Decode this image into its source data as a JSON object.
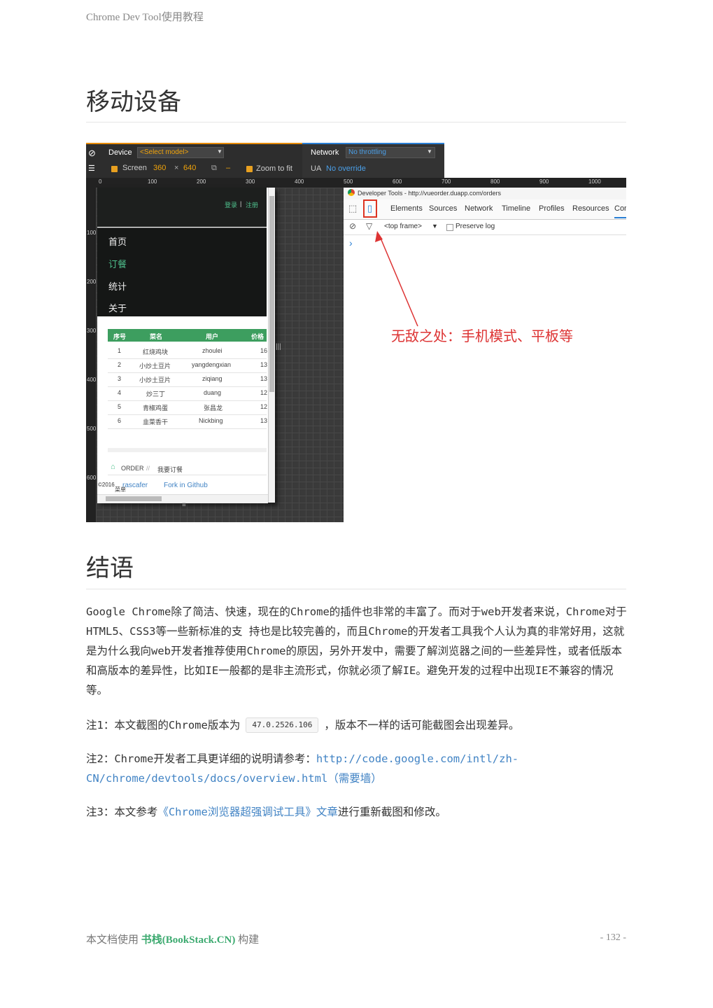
{
  "header": {
    "doc_title": "Chrome Dev Tool使用教程"
  },
  "section1": {
    "title": "移动设备"
  },
  "screenshot": {
    "toolbar": {
      "device_label": "Device",
      "device_select": "<Select model>",
      "screen_label": "Screen",
      "width": "360",
      "times": "×",
      "height": "640",
      "dash": "–",
      "zoom_label": "Zoom to fit",
      "network_label": "Network",
      "network_select": "No throttling",
      "ua_label": "UA",
      "ua_value": "No override"
    },
    "ruler_top": [
      "0",
      "100",
      "200",
      "300",
      "400",
      "500",
      "600",
      "700",
      "800",
      "900",
      "1000"
    ],
    "ruler_left": [
      "100",
      "200",
      "300",
      "400",
      "500",
      "600"
    ],
    "phone": {
      "login": "登录",
      "sep": "|",
      "register": "注册",
      "menu": [
        "首页",
        "订餐",
        "统计",
        "关于"
      ],
      "table_headers": [
        "序号",
        "菜名",
        "用户",
        "价格"
      ],
      "rows": [
        [
          "1",
          "红烧鸡块",
          "zhoulei",
          "16"
        ],
        [
          "2",
          "小炒土豆片",
          "yangdengxian",
          "13"
        ],
        [
          "3",
          "小炒土豆片",
          "ziqiang",
          "13"
        ],
        [
          "4",
          "炒三丁",
          "duang",
          "12"
        ],
        [
          "5",
          "青椒鸡蛋",
          "张昌龙",
          "12"
        ],
        [
          "6",
          "韭菜香干",
          "Nickbing",
          "13"
        ]
      ],
      "breadcrumb_order": "ORDER",
      "breadcrumb_sep": "//",
      "breadcrumb_mine": "我要订餐",
      "footer_copy": "©2016",
      "footer_author": "rascafer",
      "footer_fork": "Fork in Github",
      "footer_menu": "菜单"
    },
    "devtools": {
      "window_title": "Developer Tools - http://vueorder.duapp.com/orders",
      "tabs": [
        "Elements",
        "Sources",
        "Network",
        "Timeline",
        "Profiles",
        "Resources",
        "Cor"
      ],
      "frame": "<top frame>",
      "preserve_log": "Preserve log",
      "prompt": "›"
    },
    "callout": "无敌之处：手机模式、平板等"
  },
  "section2": {
    "title": "结语",
    "paragraph": "Google Chrome除了简洁、快速，现在的Chrome的插件也非常的丰富了。而对于web开发者来说，Chrome对于HTML5、CSS3等一些新标准的支 持也是比较完善的，而且Chrome的开发者工具我个人认为真的非常好用，这就是为什么我向web开发者推荐使用Chrome的原因，另外开发中，需要了解浏览器之间的一些差异性，或者低版本和高版本的差异性，比如IE一般都的是非主流形式，你就必须了解IE。避免开发的过程中出现IE不兼容的情况等。",
    "note1_prefix": "注1：本文截图的Chrome版本为",
    "note1_version": "47.0.2526.106",
    "note1_suffix": "，版本不一样的话可能截图会出现差异。",
    "note2_prefix": "注2：Chrome开发者工具更详细的说明请参考：",
    "note2_link": "http://code.google.com/intl/zh-CN/chrome/devtools/docs/overview.html（需要墙）",
    "note3_prefix": "注3：本文参考",
    "note3_link": "《Chrome浏览器超强调试工具》文章",
    "note3_suffix": "进行重新截图和修改。"
  },
  "footer": {
    "prefix": "本文档使用",
    "brand": "书栈(BookStack.CN)",
    "suffix": "构建",
    "page": "- 132 -"
  }
}
